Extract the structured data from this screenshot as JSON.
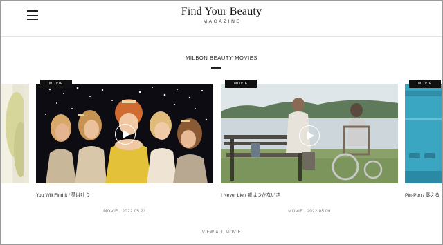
{
  "header": {
    "menu_icon": "hamburger-menu-icon",
    "logo_title": "Find Your Beauty",
    "logo_subtitle": "MAGAZINE"
  },
  "section": {
    "title": "MILBON BEAUTY MOVIES"
  },
  "cards": [
    {
      "badge": "",
      "title": "",
      "meta": ""
    },
    {
      "badge": "MOVIE",
      "title": "You Will Find It / 夢は叶う！",
      "meta": "MOVIE | 2022.05.23"
    },
    {
      "badge": "MOVIE",
      "title": "I Never Lie / 嘘はつかないさ",
      "meta": "MOVIE | 2022.05.09"
    },
    {
      "badge": "MOVIE",
      "title": "Pin-Pon / 奏える",
      "meta": ""
    }
  ],
  "view_all": "VIEW ALL MOVIE",
  "colors": {
    "badge_bg": "#111111",
    "pool_blue": "#3aa6c2",
    "lake_sky": "#dfe6ea",
    "dress_yellow": "#e3c23a"
  }
}
